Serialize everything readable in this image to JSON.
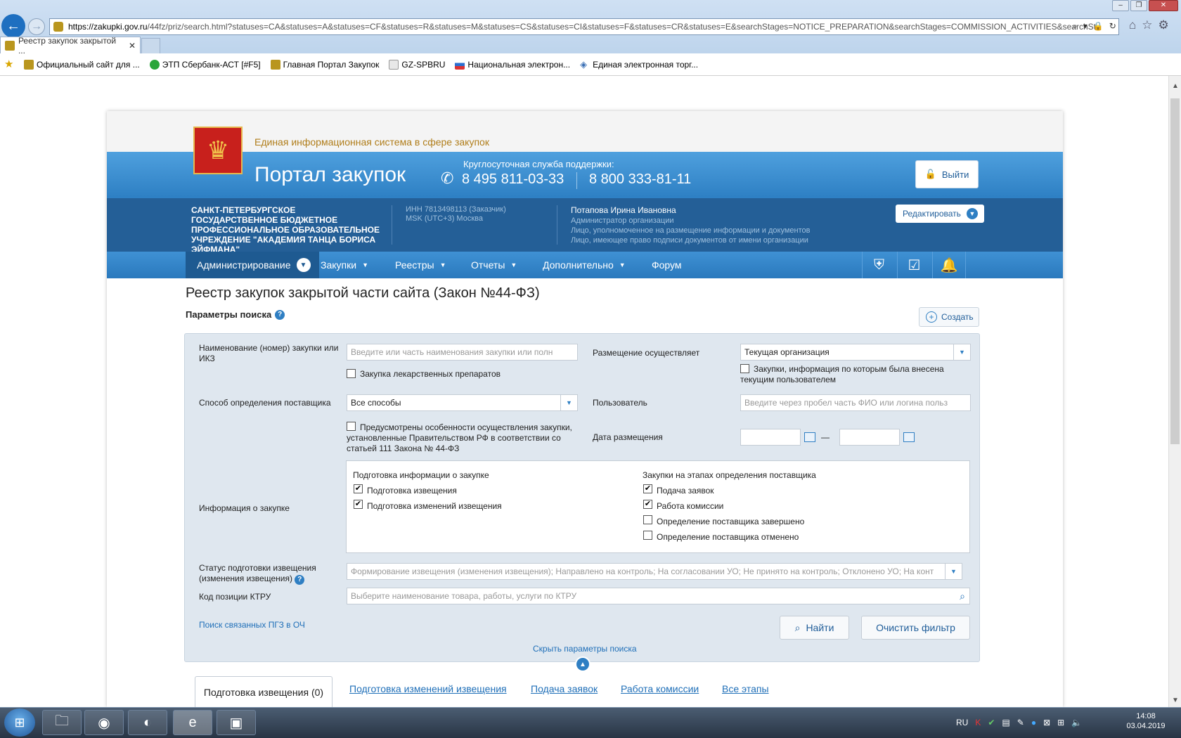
{
  "browser": {
    "url_host": "https://zakupki.gov.ru",
    "url_path": "/44fz/priz/search.html?statuses=CA&statuses=A&statuses=CF&statuses=R&statuses=M&statuses=CS&statuses=CI&statuses=F&statuses=CR&statuses=E&searchStages=NOTICE_PREPARATION&searchStages=COMMISSION_ACTIVITIES&searchSt",
    "tab_title": "Реестр закупок закрытой ...",
    "favorites": [
      "Официальный сайт для ...",
      "ЭТП Сбербанк-АСТ [#F5]",
      "Главная Портал Закупок",
      "GZ-SPBRU",
      "Национальная электрон...",
      "Единая электронная торг..."
    ]
  },
  "header": {
    "eis": "Единая информационная система в сфере закупок",
    "portal": "Портал закупок",
    "support_label": "Круглосуточная служба поддержки:",
    "phone1": "8 495 811-03-33",
    "phone2": "8 800 333-81-11",
    "exit": "Выйти"
  },
  "org": {
    "name": "САНКТ-ПЕТЕРБУРГСКОЕ ГОСУДАРСТВЕННОЕ БЮДЖЕТНОЕ ПРОФЕССИОНАЛЬНОЕ ОБРАЗОВАТЕЛЬНОЕ УЧРЕЖДЕНИЕ \"АКАДЕМИЯ ТАНЦА БОРИСА ЭЙФМАНА\"",
    "inn": "ИНН 7813498113 (Заказчик)",
    "tz": "MSK (UTC+3) Москва",
    "user": "Потапова Ирина Ивановна",
    "role1": "Администратор организации",
    "role2": "Лицо, уполномоченное на размещение информации и документов",
    "role3": "Лицо, имеющее право подписи документов от имени организации",
    "edit": "Редактировать"
  },
  "menu": [
    "Администрирование",
    "Закупки",
    "Реестры",
    "Отчеты",
    "Дополнительно",
    "Форум"
  ],
  "page": {
    "title": "Реестр закупок закрытой части сайта (Закон №44-ФЗ)",
    "search_params": "Параметры поиска",
    "create": "Создать"
  },
  "filter": {
    "name_label": "Наименование (номер) закупки или ИКЗ",
    "name_placeholder": "Введите или часть наименования закупки или полн",
    "drugs": "Закупка лекарственных препаратов",
    "placement_label": "Размещение осуществляет",
    "placement_value": "Текущая организация",
    "placement_cb": "Закупки, информация по которым была внесена текущим пользователем",
    "method_label": "Способ определения поставщика",
    "method_value": "Все способы",
    "user_label": "Пользователь",
    "user_placeholder": "Введите через пробел часть ФИО или логина польз",
    "special_cb": "Предусмотрены особенности осуществления закупки, установленные Правительством РФ в соответствии со статьей 111 Закона № 44-ФЗ",
    "date_label": "Дата размещения",
    "date_dash": "—",
    "info_label": "Информация о закупке",
    "prep_title": "Подготовка информации о закупке",
    "prep1": "Подготовка извещения",
    "prep2": "Подготовка изменений извещения",
    "stage_title": "Закупки на этапах определения поставщика",
    "stage1": "Подача заявок",
    "stage2": "Работа комиссии",
    "stage3": "Определение поставщика завершено",
    "stage4": "Определение поставщика отменено",
    "status_label": "Статус подготовки извещения (изменения извещения)",
    "status_value": "Формирование извещения (изменения извещения); Направлено на контроль; На согласовании УО; Не принято на контроль; Отклонено УО; На конт",
    "ktru_label": "Код позиции КТРУ",
    "ktru_placeholder": "Выберите наименование товара, работы, услуги по КТРУ",
    "related_link": "Поиск связанных ПГЗ в ОЧ",
    "find": "Найти",
    "clear": "Очистить фильтр",
    "hide": "Скрыть параметры поиска"
  },
  "tabs": [
    "Подготовка извещения (0)",
    "Подготовка изменений извещения",
    "Подача заявок",
    "Работа комиссии",
    "Все этапы"
  ],
  "taskbar": {
    "lang": "RU",
    "time": "14:08",
    "date": "03.04.2019"
  }
}
